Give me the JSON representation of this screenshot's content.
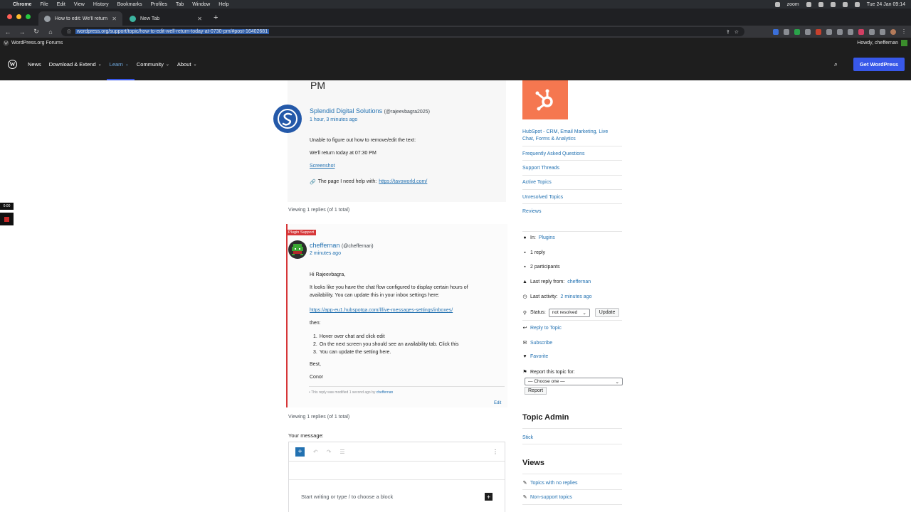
{
  "macos": {
    "app": "Chrome",
    "menus": [
      "File",
      "Edit",
      "View",
      "History",
      "Bookmarks",
      "Profiles",
      "Tab",
      "Window",
      "Help"
    ],
    "zoom": "zoom",
    "datetime": "Tue 24 Jan  09:14"
  },
  "browser": {
    "tabs": [
      {
        "title": "How to edit: We'll return today"
      },
      {
        "title": "New Tab"
      }
    ],
    "url": "wordpress.org/support/topic/how-to-edit-well-return-today-at-0730-pm/#post-16402681"
  },
  "forums_bar": {
    "site": "WordPress.org Forums",
    "howdy": "Howdy, cheffernan"
  },
  "nav": {
    "items": [
      "News",
      "Download & Extend",
      "Learn",
      "Community",
      "About"
    ],
    "cta": "Get WordPress"
  },
  "recording": {
    "time": "0:00"
  },
  "topic": {
    "title_tail": "PM",
    "author": "Splendid Digital Solutions",
    "handle": "(@rajeevbagra2025)",
    "time": "1 hour, 3 minutes ago",
    "line1": "Unable to figure out how to remove/edit the text:",
    "line2": "We'll return today at 07:30 PM",
    "screenshot": "Screenshot",
    "page_help_label": "The page I need help with:",
    "page_help_url": "https://tavoworld.com/"
  },
  "viewing": "Viewing 1 replies (of 1 total)",
  "reply": {
    "badge": "Plugin Support",
    "author": "cheffernan",
    "handle": "(@cheffernan)",
    "time": "2 minutes ago",
    "greeting": "Hi Rajeevbagra,",
    "para1a": "It looks like you have the chat flow configured to display certain hours of",
    "para1b": "availability. You can update this in your inbox settings here:",
    "link": "https://app-eu1.hubspotqa.com/l/live-messages-settings/inboxes/",
    "then": "then:",
    "steps": [
      "Hover over chat and click edit",
      "On the next screen you should see an availability tab. Click this",
      "You can update the setting here."
    ],
    "sign1": "Best,",
    "sign2": "Conor",
    "modified_prefix": "This reply was modified 1 second ago by",
    "modified_by": "cheffernan",
    "edit": "Edit"
  },
  "composer": {
    "label": "Your message:",
    "placeholder": "Start writing or type / to choose a block"
  },
  "sidebar": {
    "plugin_name_1": "HubSpot - CRM, Email Marketing, Live",
    "plugin_name_2": "Chat, Forms & Analytics",
    "links": [
      "Frequently Asked Questions",
      "Support Threads",
      "Active Topics",
      "Unresolved Topics",
      "Reviews"
    ],
    "in_label": "In:",
    "in_value": "Plugins",
    "replies": "1 reply",
    "participants": "2 participants",
    "last_reply_label": "Last reply from:",
    "last_reply_value": "cheffernan",
    "last_activity_label": "Last activity:",
    "last_activity_value": "2 minutes ago",
    "status_label": "Status:",
    "status_value": "not resolved",
    "update": "Update",
    "reply_to_topic": "Reply to Topic",
    "subscribe": "Subscribe",
    "favorite": "Favorite",
    "report_label": "Report this topic for:",
    "report_select": "— Choose one —",
    "report_button": "Report",
    "topic_admin": "Topic Admin",
    "stick": "Stick",
    "views": "Views",
    "view_links": [
      "Topics with no replies",
      "Non-support topics"
    ]
  }
}
